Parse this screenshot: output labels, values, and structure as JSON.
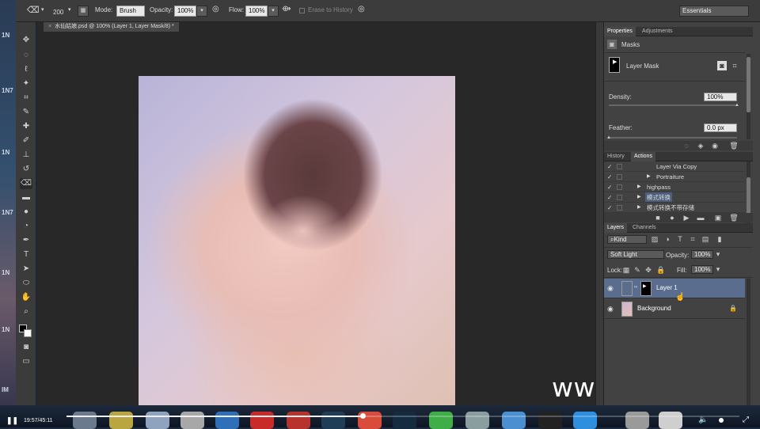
{
  "desktop": {
    "labels": [
      "1N",
      "1N7",
      "1N",
      "1N7",
      "1N",
      "1N",
      "IM"
    ]
  },
  "options_bar": {
    "brush_size": "200",
    "mode_label": "Mode:",
    "mode_value": "Brush",
    "opacity_label": "Opacity:",
    "opacity_value": "100%",
    "flow_label": "Flow:",
    "flow_value": "100%",
    "erase_to_history": "Erase to History",
    "workspace": "Essentials"
  },
  "document": {
    "tab_title": "水仙姑娘.psd @ 100% (Layer 1, Layer Mask/8) *",
    "watermark": "www.hunls.com"
  },
  "properties": {
    "tabs": [
      "Properties",
      "Adjustments"
    ],
    "section": "Masks",
    "mask_label": "Layer Mask",
    "density_label": "Density:",
    "density_value": "100%",
    "density_level": 1.0,
    "feather_label": "Feather:",
    "feather_value": "0.0 px",
    "feather_level": 0.0
  },
  "history": {
    "tabs": [
      "History",
      "Actions"
    ],
    "items": [
      {
        "label": "Layer Via Copy",
        "indent": 2,
        "arrow": false,
        "selected": false
      },
      {
        "label": "Portraiture",
        "indent": 2,
        "arrow": true,
        "selected": false
      },
      {
        "label": "highpass",
        "indent": 1,
        "arrow": true,
        "selected": false
      },
      {
        "label": "模式转换",
        "indent": 1,
        "arrow": true,
        "selected": true
      },
      {
        "label": "模式转换不带存储",
        "indent": 1,
        "arrow": true,
        "selected": false
      }
    ]
  },
  "layers": {
    "tabs": [
      "Layers",
      "Channels"
    ],
    "filter_label": "Kind",
    "blend_mode": "Soft Light",
    "opacity_label": "Opacity:",
    "opacity_value": "100%",
    "lock_label": "Lock:",
    "fill_label": "Fill:",
    "fill_value": "100%",
    "items": [
      {
        "name": "Layer 1",
        "selected": true
      },
      {
        "name": "Background",
        "selected": false
      }
    ]
  },
  "player": {
    "time": "19:57/45:11",
    "progress": 0.44
  }
}
